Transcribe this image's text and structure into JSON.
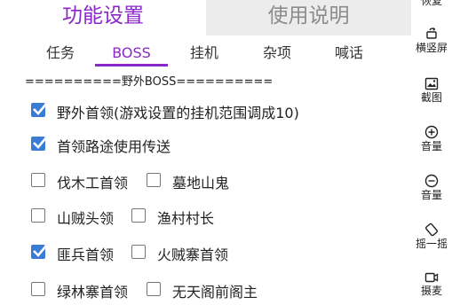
{
  "top_tabs": {
    "active": "功能设置",
    "inactive": "使用说明"
  },
  "sub_tabs": [
    "任务",
    "BOSS",
    "挂机",
    "杂项",
    "喊话"
  ],
  "section_header": "==========野外BOSS==========",
  "options": [
    {
      "label": "野外首领(游戏设置的挂机范围调成10)",
      "checked": true
    },
    {
      "label": "首领路途使用传送",
      "checked": true
    },
    {
      "label": "伐木工首领",
      "checked": false
    },
    {
      "label": "墓地山鬼",
      "checked": false
    },
    {
      "label": "山贼头领",
      "checked": false
    },
    {
      "label": "渔村村长",
      "checked": false
    },
    {
      "label": "匪兵首领",
      "checked": true
    },
    {
      "label": "火贼寨首领",
      "checked": false
    },
    {
      "label": "绿林寨首领",
      "checked": false
    },
    {
      "label": "无天阁前阁主",
      "checked": false
    }
  ],
  "toolbar": {
    "restore": "恢复",
    "rotate": "横竖屏",
    "screenshot": "截图",
    "volume_up": "音量",
    "volume_down": "音量",
    "shake": "摇一摇",
    "record": "摄麦"
  },
  "colors": {
    "accent": "#8a27c9",
    "checkbox": "#3a7bd5"
  }
}
